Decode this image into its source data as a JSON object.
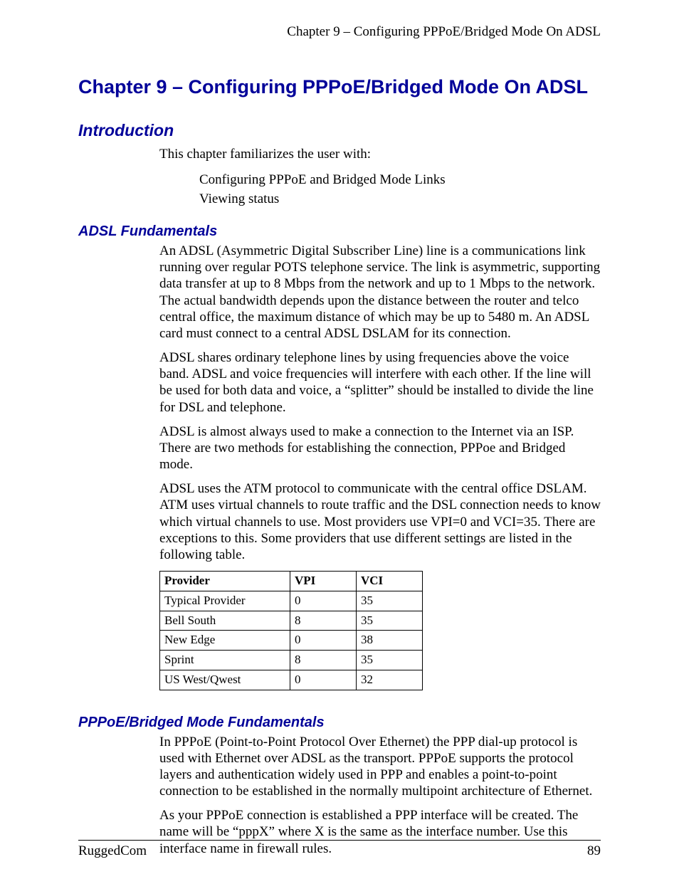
{
  "running_head": "Chapter 9 – Configuring PPPoE/Bridged Mode On ADSL",
  "chapter_title": "Chapter 9 – Configuring PPPoE/Bridged Mode On ADSL",
  "intro": {
    "heading": "Introduction",
    "lead": "This chapter familiarizes the user with:",
    "bullets": [
      "Configuring PPPoE and Bridged Mode Links",
      "Viewing status"
    ]
  },
  "adsl": {
    "heading": "ADSL Fundamentals",
    "p1": "An ADSL (Asymmetric Digital Subscriber Line) line is a communications link running over regular POTS telephone service.  The link is asymmetric, supporting data transfer at up to 8 Mbps from the network and up to 1 Mbps to the network.  The actual bandwidth depends upon the distance between the router and telco central office, the maximum distance of which may be up to 5480 m.  An ADSL card must connect to a central ADSL DSLAM for its connection.",
    "p2": "ADSL shares ordinary telephone lines by using frequencies above the voice band.  ADSL and voice frequencies will interfere with each other.  If the line will be used for both data and voice, a “splitter” should be installed to divide the line for DSL and telephone.",
    "p3": "ADSL is almost always used to make a connection to the Internet via an ISP.  There are two methods for establishing the connection, PPPoe and Bridged mode.",
    "p4": "ADSL uses the ATM protocol to communicate with the central office DSLAM.  ATM uses virtual channels to route traffic and the DSL connection needs to know which virtual channels to use.  Most providers use VPI=0 and VCI=35.  There are exceptions to this.  Some providers that use different settings are listed in the following table."
  },
  "table": {
    "headers": {
      "provider": "Provider",
      "vpi": "VPI",
      "vci": "VCI"
    },
    "rows": [
      {
        "provider": "Typical Provider",
        "vpi": "0",
        "vci": "35"
      },
      {
        "provider": "Bell South",
        "vpi": "8",
        "vci": "35"
      },
      {
        "provider": "New Edge",
        "vpi": "0",
        "vci": "38"
      },
      {
        "provider": "Sprint",
        "vpi": "8",
        "vci": "35"
      },
      {
        "provider": "US West/Qwest",
        "vpi": "0",
        "vci": "32"
      }
    ]
  },
  "pppoe": {
    "heading": "PPPoE/Bridged Mode Fundamentals",
    "p1": "In PPPoE (Point-to-Point Protocol Over Ethernet) the PPP dial-up protocol is used with Ethernet over ADSL as the transport.  PPPoE supports the protocol layers and authentication widely used in PPP and enables a point-to-point connection to be established in the normally multipoint architecture of Ethernet.",
    "p2": "As your PPPoE connection is established a PPP interface will be created.  The name will be “pppX” where X is the same as the interface number.  Use this interface name in firewall rules."
  },
  "footer": {
    "left": "RuggedCom",
    "right": "89"
  }
}
